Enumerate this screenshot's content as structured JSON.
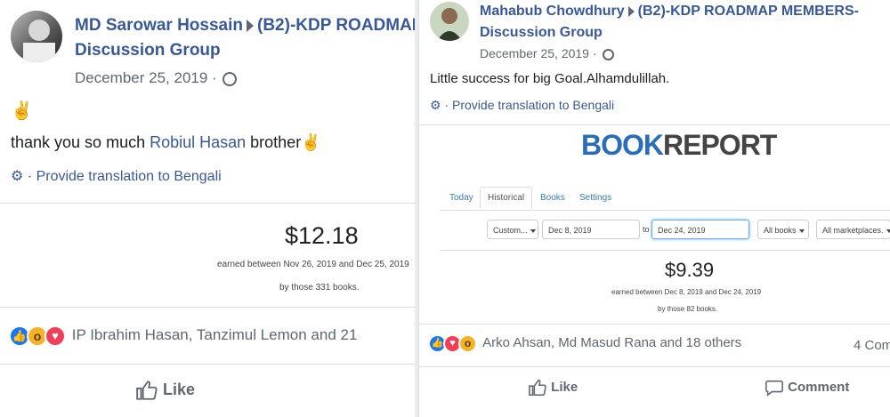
{
  "left_post": {
    "author": "MD Sarowar Hossain",
    "group_line1": "(B2)-KDP ROADMAP",
    "group_line2": "Discussion Group",
    "date": "December 25, 2019",
    "emoji": "✌",
    "body_prefix": "thank you so much ",
    "body_link": "Robiul Hasan",
    "body_suffix": " brother",
    "body_emoji": "✌",
    "translate": "Provide translation to Bengali",
    "card": {
      "amount": "$12.18",
      "earned": "earned between Nov 26, 2019 and Dec 25, 2019",
      "books": "by those 331 books."
    },
    "reactions_text": "IP Ibrahim Hasan, Tanzimul Lemon and 21",
    "like": "Like"
  },
  "right_post": {
    "author": "Mahabub Chowdhury",
    "group_line1": "(B2)-KDP ROADMAP MEMBERS-",
    "group_line2": "Discussion Group",
    "date": "December 25, 2019",
    "body": "Little success for big Goal.Alhamdulillah.",
    "translate": "Provide translation to Bengali",
    "report": {
      "logo_book": "BOOK",
      "logo_report": "REPORT",
      "tabs": [
        "Today",
        "Historical",
        "Books",
        "Settings"
      ],
      "active_tab": "Historical",
      "range_select": "Custom...",
      "date_from": "Dec 8, 2019",
      "to_label": "to",
      "date_to": "Dec 24, 2019",
      "books_select": "All books",
      "market_select": "All marketplaces.",
      "amount": "$9.39",
      "earned": "earned between Dec 8, 2019 and Dec 24, 2019",
      "books": "by those 82 books."
    },
    "reactions_text": "Arko Ahsan, Md Masud Rana and 18 others",
    "comments_count": "4 Com",
    "like": "Like",
    "comment": "Comment"
  },
  "colors": {
    "link": "#385898",
    "like_blue": "#1877f2",
    "love_red": "#f33e58",
    "wow_yellow": "#f7b125",
    "logo_blue": "#2a6ebb"
  }
}
